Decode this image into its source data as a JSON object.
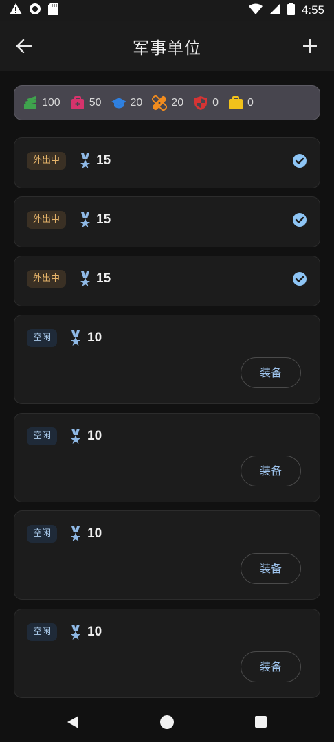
{
  "status_bar": {
    "time": "4:55",
    "icons": [
      "warning-icon",
      "record-icon",
      "sd-card-icon",
      "wifi-icon",
      "signal-icon",
      "battery-icon"
    ]
  },
  "app_bar": {
    "title": "军事单位",
    "back_icon": "arrow-left-icon",
    "add_icon": "plus-icon"
  },
  "resources": [
    {
      "icon": "money-icon",
      "value": "100",
      "color": "#3fa34d"
    },
    {
      "icon": "medkit-icon",
      "value": "50",
      "color": "#d6336c"
    },
    {
      "icon": "graduation-cap-icon",
      "value": "20",
      "color": "#2f80e0"
    },
    {
      "icon": "bandage-icon",
      "value": "20",
      "color": "#f28c1e"
    },
    {
      "icon": "shield-icon",
      "value": "0",
      "color": "#d63434"
    },
    {
      "icon": "briefcase-icon",
      "value": "0",
      "color": "#f2c21b"
    }
  ],
  "units": [
    {
      "status": "外出中",
      "level": "15",
      "selected": true
    },
    {
      "status": "外出中",
      "level": "15",
      "selected": true
    },
    {
      "status": "外出中",
      "level": "15",
      "selected": true
    },
    {
      "status": "空闲",
      "level": "10",
      "action": "装备"
    },
    {
      "status": "空闲",
      "level": "10",
      "action": "装备"
    },
    {
      "status": "空闲",
      "level": "10",
      "action": "装备"
    },
    {
      "status": "空闲",
      "level": "10",
      "action": "装备"
    }
  ],
  "colors": {
    "accent": "#9ec3ec",
    "out_badge_text": "#e6b46a",
    "check": "#8ec5f5"
  }
}
